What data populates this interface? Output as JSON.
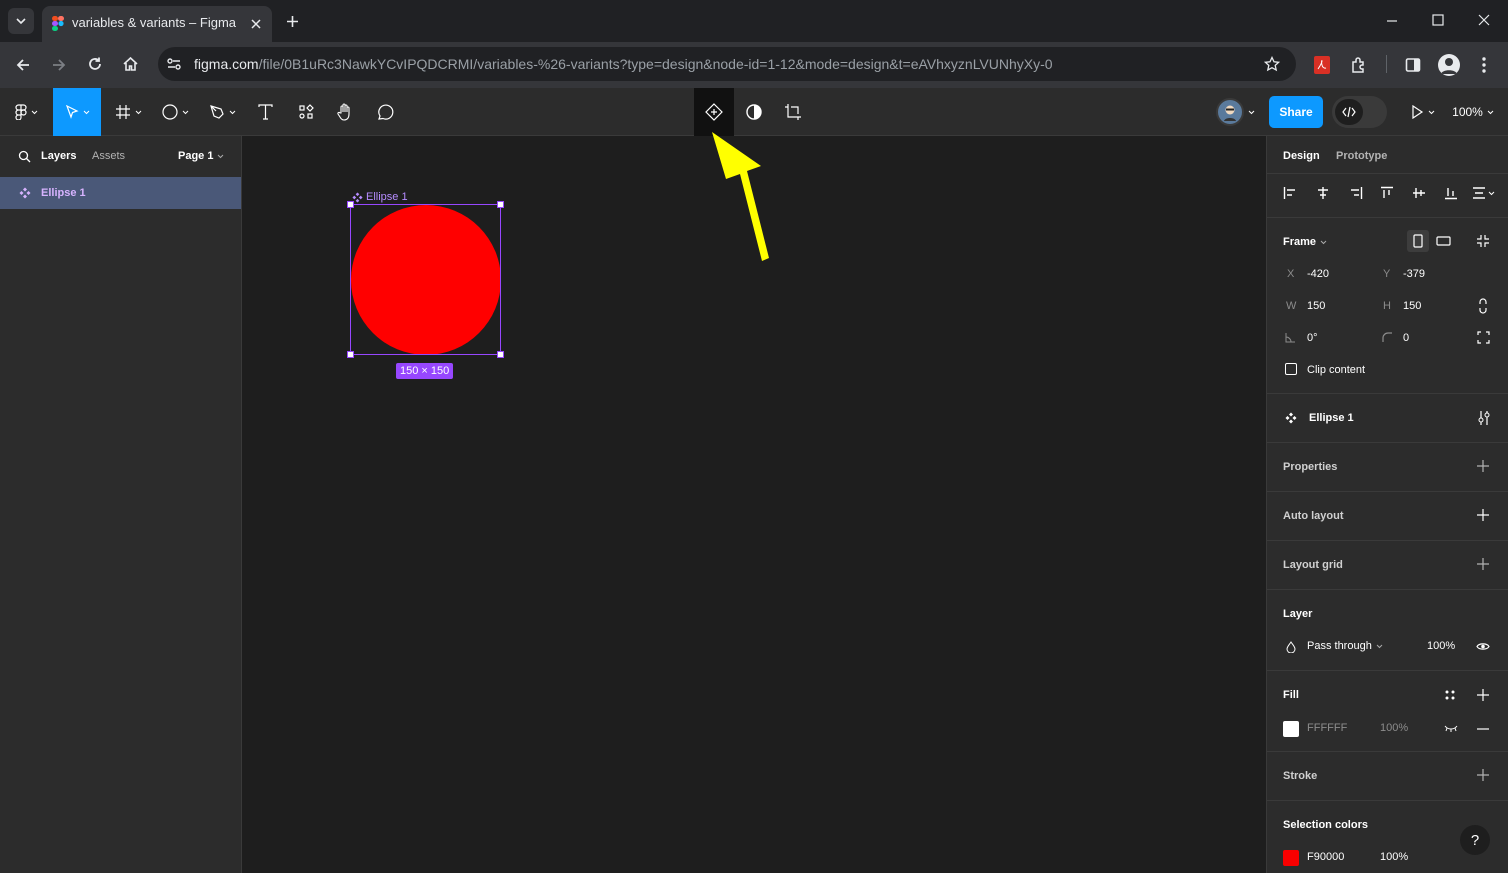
{
  "browser": {
    "tab_title": "variables & variants – Figma",
    "url_host": "figma.com",
    "url_path": "/file/0B1uRc3NawkYCvIPQDCRMI/variables-%26-variants?type=design&node-id=1-12&mode=design&t=eAVhxyznLVUNhyXy-0"
  },
  "toolbar": {
    "share_label": "Share",
    "zoom": "100%"
  },
  "left_panel": {
    "tabs": [
      "Layers",
      "Assets"
    ],
    "page": "Page 1",
    "layers": [
      {
        "name": "Ellipse 1",
        "selected": true
      }
    ]
  },
  "canvas": {
    "frame_label": "Ellipse 1",
    "size_badge": "150 × 150",
    "ellipse_color": "#FF0000",
    "selection_color": "#9747FF",
    "annotation_arrow_color": "#FFFF00"
  },
  "right_panel": {
    "tabs": [
      "Design",
      "Prototype"
    ],
    "frame": {
      "title": "Frame",
      "x_label": "X",
      "x": "-420",
      "y_label": "Y",
      "y": "-379",
      "w_label": "W",
      "w": "150",
      "h_label": "H",
      "h": "150",
      "rotation": "0°",
      "radius": "0",
      "clip_content": "Clip content"
    },
    "component": "Ellipse 1",
    "sections": {
      "properties": "Properties",
      "auto_layout": "Auto layout",
      "layout_grid": "Layout grid",
      "layer": "Layer",
      "fill": "Fill",
      "stroke": "Stroke",
      "selection_colors": "Selection colors"
    },
    "layer": {
      "blend": "Pass through",
      "opacity": "100%"
    },
    "fill": {
      "hex": "FFFFFF",
      "opacity": "100%",
      "swatch": "#FFFFFF"
    },
    "selection_color": {
      "hex": "F90000",
      "opacity": "100%",
      "swatch": "#F90000"
    }
  }
}
